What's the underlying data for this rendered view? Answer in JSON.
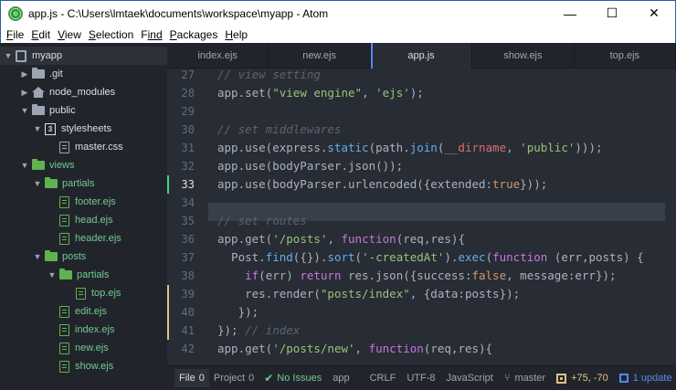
{
  "window": {
    "title": "app.js - C:\\Users\\lmtaek\\documents\\workspace\\myapp - Atom",
    "minimize_glyph": "—",
    "maximize_glyph": "☐",
    "close_glyph": "✕"
  },
  "menu": {
    "items": [
      {
        "u": "F",
        "rest": "ile"
      },
      {
        "u": "E",
        "rest": "dit"
      },
      {
        "u": "V",
        "rest": "iew"
      },
      {
        "u": "S",
        "rest": "election"
      },
      {
        "u": "F",
        "rest": "ind"
      },
      {
        "u": "P",
        "rest": "ackages"
      },
      {
        "u": "H",
        "rest": "elp"
      }
    ]
  },
  "tree": {
    "items": [
      {
        "label": "myapp",
        "type": "repo",
        "expanded": true
      },
      {
        "label": ".git",
        "type": "folder-grey",
        "expanded": false
      },
      {
        "label": "node_modules",
        "type": "home",
        "expanded": false
      },
      {
        "label": "public",
        "type": "folder-grey",
        "expanded": true
      },
      {
        "label": "stylesheets",
        "type": "css",
        "expanded": true
      },
      {
        "label": "master.css",
        "type": "file-plain"
      },
      {
        "label": "views",
        "type": "folder-green",
        "expanded": true
      },
      {
        "label": "partials",
        "type": "folder-green",
        "expanded": true
      },
      {
        "label": "footer.ejs",
        "type": "file"
      },
      {
        "label": "head.ejs",
        "type": "file"
      },
      {
        "label": "header.ejs",
        "type": "file"
      },
      {
        "label": "posts",
        "type": "folder-green",
        "expanded": true
      },
      {
        "label": "partials",
        "type": "folder-green",
        "expanded": true
      },
      {
        "label": "top.ejs",
        "type": "file"
      },
      {
        "label": "edit.ejs",
        "type": "file"
      },
      {
        "label": "index.ejs",
        "type": "file"
      },
      {
        "label": "new.ejs",
        "type": "file"
      },
      {
        "label": "show.ejs",
        "type": "file"
      }
    ]
  },
  "tabs": [
    {
      "label": "index.ejs",
      "active": false
    },
    {
      "label": "new.ejs",
      "active": false
    },
    {
      "label": "app.js",
      "active": true
    },
    {
      "label": "show.ejs",
      "active": false
    },
    {
      "label": "top.ejs",
      "active": false
    }
  ],
  "editor": {
    "line_numbers": [
      "27",
      "28",
      "29",
      "30",
      "31",
      "32",
      "33",
      "34",
      "35",
      "36",
      "37",
      "38",
      "39",
      "40",
      "41",
      "42"
    ],
    "code": {
      "l27": "// view setting",
      "l28a": "app.set(",
      "l28b": "\"view engine\"",
      "l28c": ", ",
      "l28d": "'ejs'",
      "l28e": ");",
      "l30": "// set middlewares",
      "l31a": "app.use(express.",
      "l31b": "static",
      "l31c": "(path.",
      "l31d": "join",
      "l31e": "(",
      "l31f": "__dirname",
      "l31g": ", ",
      "l31h": "'public'",
      "l31i": ")));",
      "l32": "app.use(bodyParser.json());",
      "l33a": "app.use(bodyParser.urlencoded({extended:",
      "l33b": "true",
      "l33c": "}));",
      "l35": "// set routes",
      "l36a": "app.get(",
      "l36b": "'/posts'",
      "l36c": ", ",
      "l36d": "function",
      "l36e": "(req,res){",
      "l37a": "  Post.",
      "l37b": "find",
      "l37c": "({}).",
      "l37d": "sort",
      "l37e": "(",
      "l37f": "'-createdAt'",
      "l37g": ").",
      "l37h": "exec",
      "l37i": "(",
      "l37j": "function",
      "l37k": " (err,posts) {",
      "l38a": "    ",
      "l38b": "if",
      "l38c": "(err) ",
      "l38d": "return",
      "l38e": " res.json({success:",
      "l38f": "false",
      "l38g": ", message:err});",
      "l39a": "    res.render(",
      "l39b": "\"posts/index\"",
      "l39c": ", {data:posts});",
      "l40": "   });",
      "l41a": "}); ",
      "l41b": "// index",
      "l42a": "app.get(",
      "l42b": "'/posts/new'",
      "l42c": ", ",
      "l42d": "function",
      "l42e": "(req,res){"
    }
  },
  "status": {
    "file_label": "File",
    "file_count": "0",
    "project_label": "Project",
    "project_count": "0",
    "issues": "No Issues",
    "grammar_scope": "app",
    "line_ending": "CRLF",
    "encoding": "UTF-8",
    "language": "JavaScript",
    "branch": "master",
    "diff": "+75, -70",
    "update": "1 update"
  }
}
